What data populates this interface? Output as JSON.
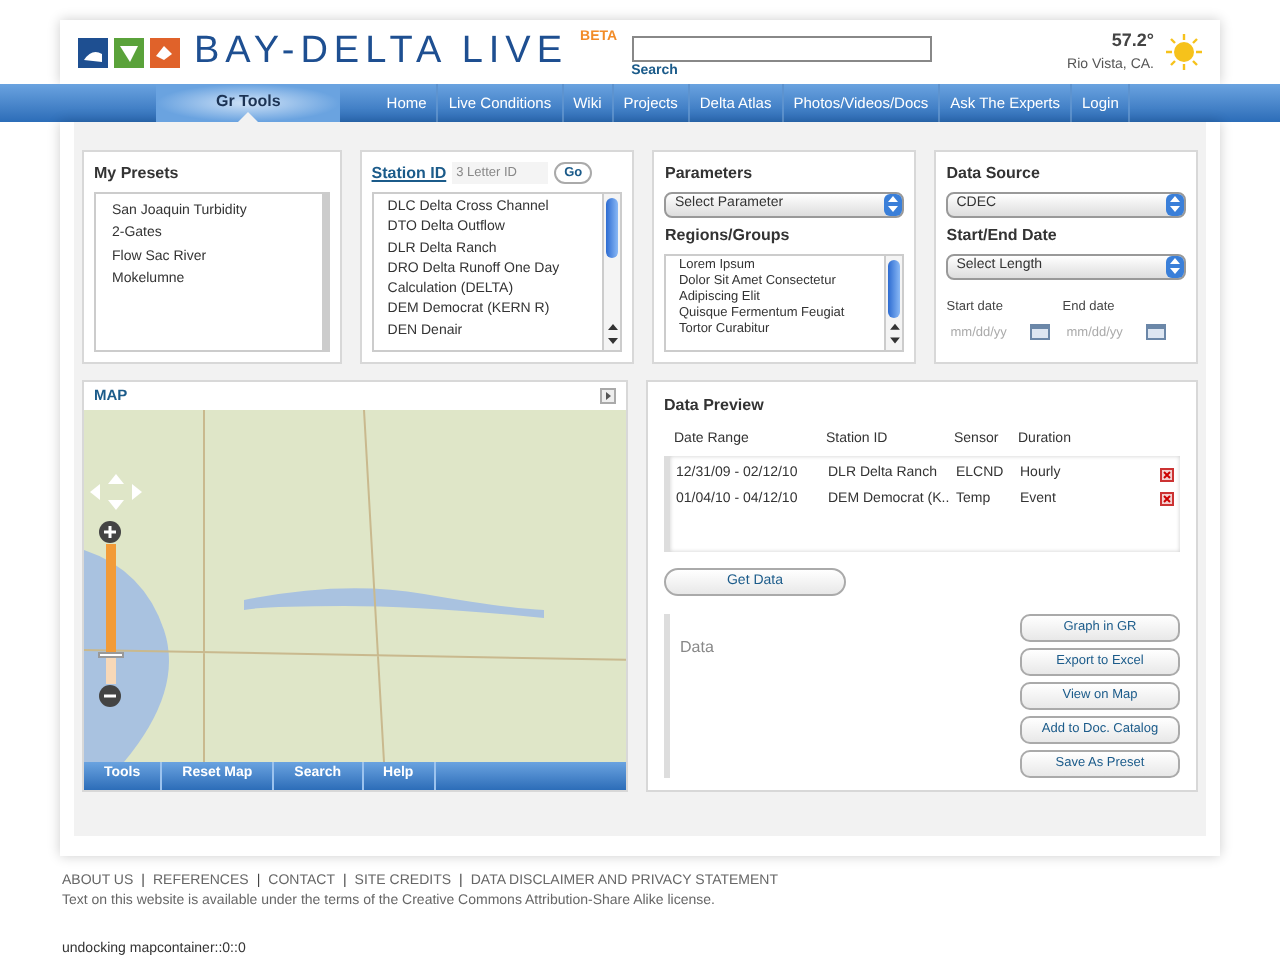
{
  "header": {
    "logo_text": "BAY-DELTA LIVE",
    "badge": "BETA",
    "search_button": "Search",
    "temperature": "57.2°",
    "location": "Rio Vista, CA."
  },
  "nav": [
    {
      "label": "Gr Tools",
      "selected": true
    },
    {
      "label": "Home",
      "selected": false
    },
    {
      "label": "Live Conditions",
      "selected": false
    },
    {
      "label": "Wiki",
      "selected": false
    },
    {
      "label": "Projects",
      "selected": false
    },
    {
      "label": "Delta Atlas",
      "selected": false
    },
    {
      "label": "Photos/Videos/Docs",
      "selected": false
    },
    {
      "label": "Ask The Experts",
      "selected": false
    },
    {
      "label": "Login",
      "selected": false
    }
  ],
  "presets": {
    "title": "My Presets",
    "items": [
      "San Joaquin Turbidity",
      "2-Gates",
      "Flow Sac River",
      "Mokelumne"
    ]
  },
  "station": {
    "title": "Station ID",
    "placeholder": "3 Letter ID",
    "go": "Go",
    "items": [
      "DLC Delta Cross Channel",
      "DTO Delta Outflow",
      "DLR Delta Ranch",
      "DRO Delta Runoff One Day Calculation (DELTA)",
      "DEM Democrat (KERN R)",
      "DEN Denair"
    ]
  },
  "parameters": {
    "title": "Parameters",
    "select": "Select Parameter",
    "regions_title": "Regions/Groups",
    "regions": [
      "Lorem Ipsum",
      "Dolor Sit Amet Consectetur",
      "Adipiscing Elit",
      "Quisque Fermentum Feugiat",
      "Tortor Curabitur"
    ]
  },
  "data_source": {
    "title": "Data Source",
    "select": "CDEC",
    "date_title": "Start/End Date",
    "length_select": "Select Length",
    "start_label": "Start date",
    "start_placeholder": "mm/dd/yy",
    "end_label": "End date",
    "end_placeholder": "mm/dd/yy"
  },
  "map": {
    "title": "MAP",
    "zoom": {
      "level": 0.8
    },
    "toolbar": [
      "Tools",
      "Reset Map",
      "Search",
      "Help"
    ]
  },
  "preview": {
    "title": "Data Preview",
    "columns": [
      "Date Range",
      "Station ID",
      "Sensor",
      "Duration"
    ],
    "rows": [
      [
        "12/31/09 - 02/12/10",
        "DLR Delta Ranch",
        "ELCND",
        "Hourly"
      ],
      [
        "01/04/10 - 04/12/10",
        "DEM Democrat (K..",
        "Temp",
        "Event"
      ]
    ],
    "get_data": "Get Data",
    "data_label": "Data",
    "actions": [
      "Graph in GR",
      "Export to Excel",
      "View on Map",
      "Add to Doc. Catalog",
      "Save As Preset"
    ]
  },
  "footer": {
    "items": [
      {
        "kind": "link",
        "text": "ABOUT US"
      },
      {
        "kind": "separator",
        "text": "|"
      },
      {
        "kind": "link",
        "text": "REFERENCES"
      },
      {
        "kind": "separator",
        "text": "|"
      },
      {
        "kind": "link",
        "text": "CONTACT"
      },
      {
        "kind": "separator",
        "text": "|"
      },
      {
        "kind": "link",
        "text": "SITE CREDITS"
      },
      {
        "kind": "separator",
        "text": "|"
      },
      {
        "kind": "link",
        "text": "DATA DISCLAIMER AND PRIVACY STATEMENT"
      }
    ],
    "license": "Text on this website is available under the terms of the Creative Commons Attribution-Share Alike license.",
    "debug": "undocking mapcontainer::0::0"
  }
}
